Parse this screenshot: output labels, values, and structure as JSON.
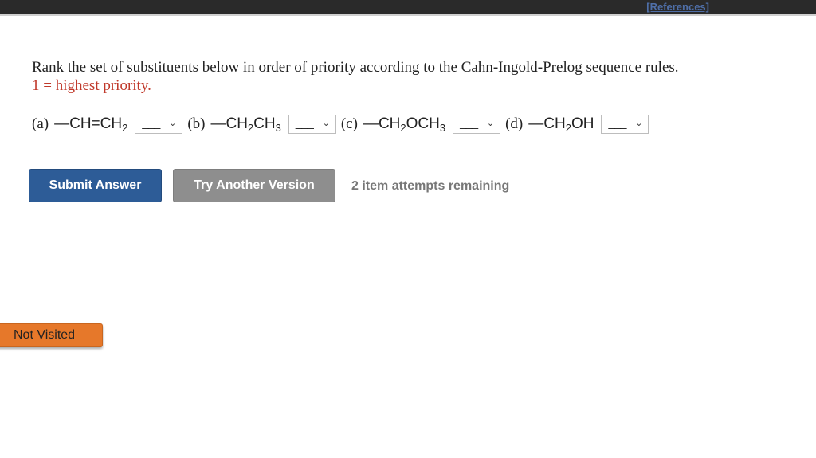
{
  "header": {
    "references_label": "[References]"
  },
  "question": {
    "prompt": "Rank the set of substituents below in order of priority according to the Cahn-Ingold-Prelog sequence rules.",
    "note": "1 = highest priority."
  },
  "items": [
    {
      "label": "(a)",
      "formula_parts": [
        "—CH=CH",
        "2",
        ""
      ],
      "selected": "___"
    },
    {
      "label": "(b)",
      "formula_parts": [
        "—CH",
        "2",
        "CH",
        "3"
      ],
      "selected": "___"
    },
    {
      "label": "(c)",
      "formula_parts": [
        "—CH",
        "2",
        "OCH",
        "3"
      ],
      "selected": "___"
    },
    {
      "label": "(d)",
      "formula_parts": [
        "—CH",
        "2",
        "OH"
      ],
      "selected": "___"
    }
  ],
  "icons": {
    "select_chevron": "chevron-down-icon"
  },
  "actions": {
    "submit_label": "Submit Answer",
    "try_another_label": "Try Another Version",
    "attempts_text": "2 item attempts remaining"
  },
  "status": {
    "not_visited_label": "Not Visited"
  },
  "colors": {
    "topbar": "#2a2a2a",
    "references_link": "#4f6fa8",
    "note_red": "#c0392b",
    "submit_bg": "#2d5c97",
    "try_bg": "#8e8e8e",
    "not_visited_bg": "#e6782a"
  }
}
